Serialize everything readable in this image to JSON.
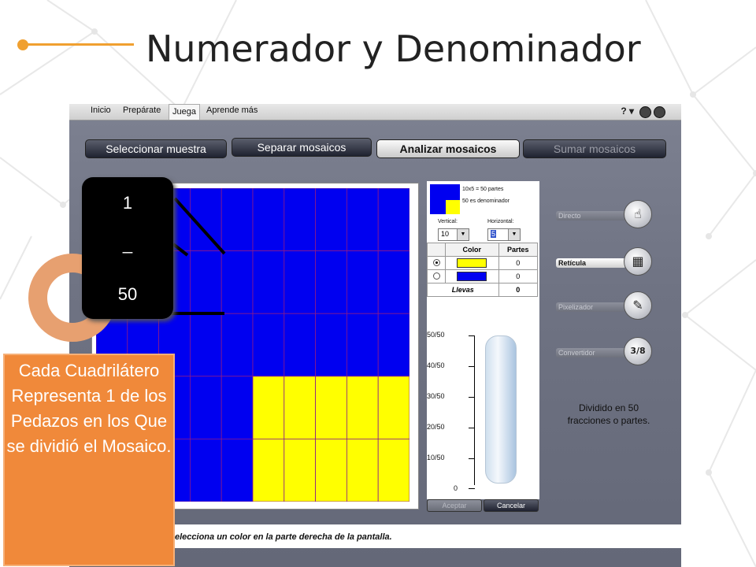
{
  "slide": {
    "title": "Numerador y Denominador"
  },
  "app": {
    "menu": [
      "Inicio",
      "Prepárate",
      "Juega",
      "Aprende más"
    ],
    "help_label": "? ▾",
    "steps": [
      "Seleccionar muestra",
      "Separar mosaicos",
      "Analizar mosaicos",
      "Sumar mosaicos"
    ],
    "info": [
      "10x5 = 50 partes",
      "50 es denominador"
    ],
    "vertical": {
      "label": "Vertical:",
      "value": "10"
    },
    "horizontal": {
      "label": "Horizontal:",
      "value": "5"
    },
    "table": {
      "headers": [
        "Color",
        "Partes"
      ],
      "rows": [
        {
          "color": "#ffff00",
          "partes": "0",
          "selected": true
        },
        {
          "color": "#0000f0",
          "partes": "0",
          "selected": false
        }
      ],
      "total_label": "Llevas",
      "total_value": "0"
    },
    "gauge": {
      "ticks": [
        "50/50",
        "40/50",
        "30/50",
        "20/50",
        "10/50",
        "0"
      ],
      "fill": 0
    },
    "buttons": {
      "accept": "Aceptar",
      "cancel": "Cancelar"
    },
    "tools": [
      {
        "label": "Directo",
        "icon": "hand-pointer-icon",
        "active": false
      },
      {
        "label": "Retícula",
        "icon": "grid-icon",
        "active": true
      },
      {
        "label": "Pixelizador",
        "icon": "eyedropper-icon",
        "active": false
      },
      {
        "label": "Convertidor",
        "icon": "fraction-icon",
        "glyph": "3/8",
        "active": false
      }
    ],
    "divided_text": "Dividido en 50 fracciones o partes.",
    "status_text": "elecciona un color en la parte derecha de la pantalla."
  },
  "mosaic": {
    "cols": 10,
    "rows": 5,
    "base_color": "#0000f0",
    "highlight_color": "#ffff00",
    "line_color": "#8a1a8a",
    "highlight": {
      "col_start": 5,
      "row_start": 3
    }
  },
  "overlay": {
    "fraction": {
      "numerator": "1",
      "bar": "_",
      "denominator": "50"
    },
    "callout": "Cada Cuadrilátero Representa 1 de los Pedazos en los Que se dividió el Mosaico.",
    "colors": {
      "accent": "#f0893a",
      "ring": "#e7a070",
      "title_line": "#f0a030"
    }
  }
}
